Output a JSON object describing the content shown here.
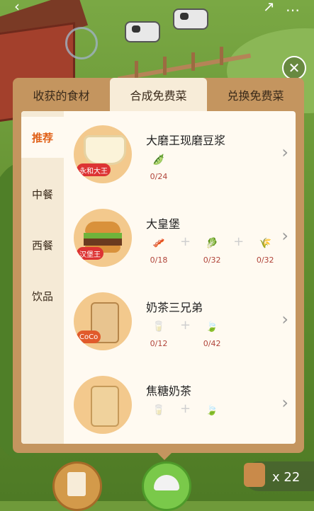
{
  "topbar": {
    "back_icon": "‹",
    "share_icon": "↗",
    "more_icon": "…"
  },
  "tabs": [
    "收获的食材",
    "合成免费菜",
    "兑换免费菜"
  ],
  "active_tab": 1,
  "sidenav": [
    "推荐",
    "中餐",
    "西餐",
    "饮品"
  ],
  "active_nav": 0,
  "items": [
    {
      "name": "大磨王现磨豆浆",
      "brand": "永和大王",
      "ingredients": [
        {
          "icon": "🫛",
          "count": "0/24"
        }
      ]
    },
    {
      "name": "大皇堡",
      "brand": "汉堡王",
      "ingredients": [
        {
          "icon": "🥓",
          "count": "0/18"
        },
        {
          "icon": "🥬",
          "count": "0/32"
        },
        {
          "icon": "🌾",
          "count": "0/32"
        }
      ]
    },
    {
      "name": "奶茶三兄弟",
      "brand": "CoCo",
      "ingredients": [
        {
          "icon": "🥛",
          "count": "0/12"
        },
        {
          "icon": "🍃",
          "count": "0/42"
        }
      ]
    },
    {
      "name": "焦糖奶茶",
      "brand": "",
      "ingredients": [
        {
          "icon": "🥛",
          "count": ""
        },
        {
          "icon": "🍃",
          "count": ""
        }
      ]
    }
  ],
  "counter": {
    "label": "x 22"
  },
  "colors": {
    "accent": "#e0621a",
    "panel": "#c4955f",
    "count": "#b0443a"
  }
}
